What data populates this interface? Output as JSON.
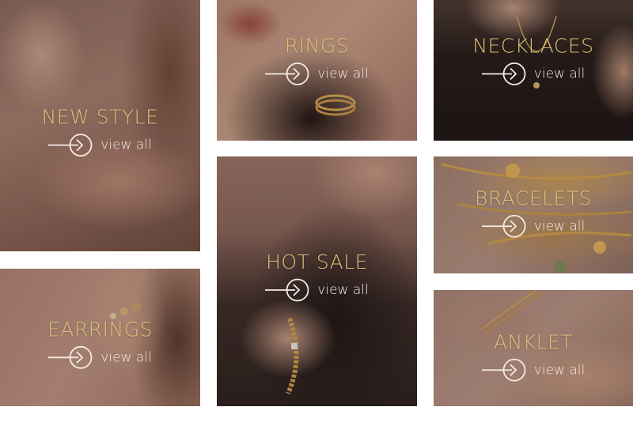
{
  "tiles": [
    {
      "title": "NEW STYLE",
      "link": "view all"
    },
    {
      "title": "RINGS",
      "link": "view all"
    },
    {
      "title": "NECKLACES",
      "link": "view all"
    },
    {
      "title": "HOT SALE",
      "link": "view all"
    },
    {
      "title": "BRACELETS",
      "link": "view all"
    },
    {
      "title": "EARRINGS",
      "link": "view all"
    },
    {
      "title": "ANKLET",
      "link": "view all"
    }
  ],
  "colors": {
    "title_gold": "#e0c27a",
    "link_text": "#f3ece6",
    "background": "#ffffff"
  },
  "icons": {
    "arrow": "circle-arrow-right-icon"
  }
}
